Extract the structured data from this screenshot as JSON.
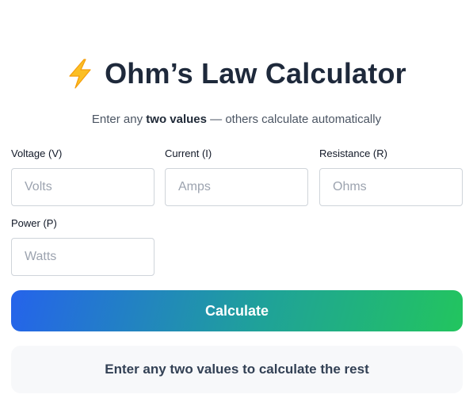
{
  "header": {
    "icon": "lightning-bolt-icon",
    "title": "Ohm’s Law Calculator"
  },
  "subtitle": {
    "prefix": "Enter any ",
    "emphasis": "two values",
    "suffix": " — others calculate automatically"
  },
  "fields": {
    "voltage": {
      "label": "Voltage (V)",
      "placeholder": "Volts",
      "value": ""
    },
    "current": {
      "label": "Current (I)",
      "placeholder": "Amps",
      "value": ""
    },
    "resistance": {
      "label": "Resistance (R)",
      "placeholder": "Ohms",
      "value": ""
    },
    "power": {
      "label": "Power (P)",
      "placeholder": "Watts",
      "value": ""
    }
  },
  "actions": {
    "calculate_label": "Calculate"
  },
  "result": {
    "message": "Enter any two values to calculate the rest"
  },
  "colors": {
    "title": "#1e293b",
    "bolt_fill": "#fbbf24",
    "bolt_stroke": "#f59e0b",
    "button_gradient_start": "#2563eb",
    "button_gradient_end": "#22c55e",
    "result_background": "#f7f8fa"
  }
}
